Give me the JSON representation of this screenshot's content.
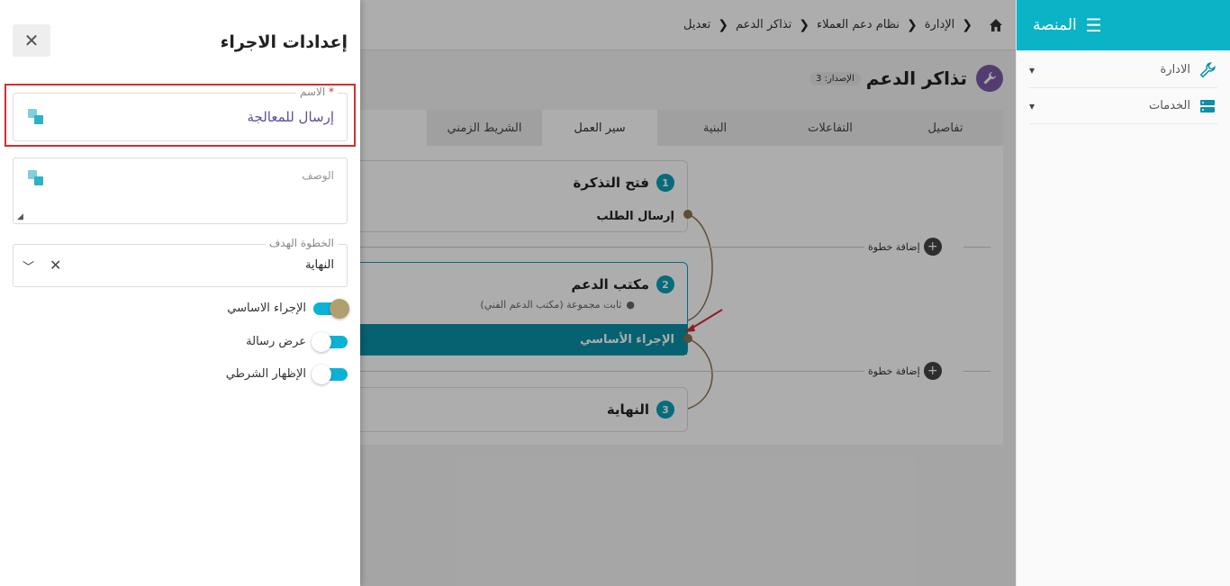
{
  "sidebar": {
    "title": "المنصة",
    "items": [
      {
        "label": "الادارة",
        "icon": "wrench-icon"
      },
      {
        "label": "الخدمات",
        "icon": "server-icon"
      }
    ]
  },
  "breadcrumb": [
    "الإدارة",
    "نظام دعم العملاء",
    "تذاكر الدعم",
    "تعديل"
  ],
  "page": {
    "title": "تذاكر الدعم",
    "version": "الإصدار: 3"
  },
  "tabs": [
    {
      "label": "تفاصيل",
      "active": false
    },
    {
      "label": "التفاعلات",
      "active": false
    },
    {
      "label": "البنية",
      "active": false
    },
    {
      "label": "سير العمل",
      "active": true
    },
    {
      "label": "الشريط الزمني",
      "active": false
    }
  ],
  "workflow": {
    "steps": [
      {
        "num": "1",
        "title": "فتح التذكرة",
        "action": "إرسال الطلب"
      },
      {
        "num": "2",
        "title": "مكتب الدعم",
        "meta": "ثابت مجموعة (مكتب الدعم الفني)",
        "action": "الإجراء الأساسي"
      },
      {
        "num": "3",
        "title": "النهاية"
      }
    ],
    "add_step_label": "إضافة خطوة"
  },
  "drawer": {
    "title": "إعدادات الاجراء",
    "name_label": "الاسم",
    "name_required": "*",
    "name_value": "إرسال للمعالجة",
    "description_label": "الوصف",
    "description_value": "",
    "target_step_label": "الخطوة الهدف",
    "target_step_value": "النهاية",
    "toggles": [
      {
        "label": "الإجراء الاساسي",
        "on": true
      },
      {
        "label": "عرض رسالة",
        "on": false
      },
      {
        "label": "الإظهار الشرطي",
        "on": false
      }
    ]
  },
  "colors": {
    "accent": "#0ab3c6",
    "highlight": "#d32f2f",
    "action_bar": "#0a8fa6"
  }
}
